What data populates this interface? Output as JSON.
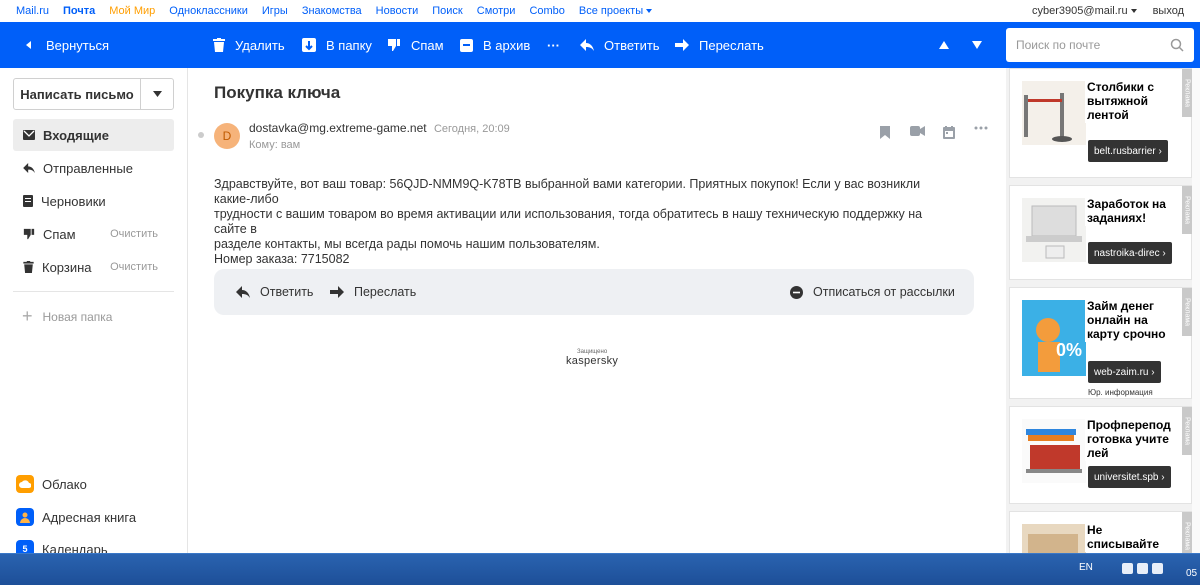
{
  "portal": {
    "links": [
      "Mail.ru",
      "Почта",
      "Мой Мир",
      "Одноклассники",
      "Игры",
      "Знакомства",
      "Новости",
      "Поиск",
      "Смотри",
      "Combo",
      "Все проекты"
    ],
    "user": "cyber3905@mail.ru",
    "logout": "выход"
  },
  "toolbar": {
    "back": "Вернуться",
    "delete": "Удалить",
    "to_folder": "В папку",
    "spam": "Спам",
    "archive": "В архив",
    "more": "···",
    "reply": "Ответить",
    "forward": "Переслать",
    "search_placeholder": "Поиск по почте"
  },
  "sidebar": {
    "compose": "Написать письмо",
    "folders": [
      {
        "label": "Входящие"
      },
      {
        "label": "Отправленные"
      },
      {
        "label": "Черновики"
      },
      {
        "label": "Спам",
        "action": "Очистить"
      },
      {
        "label": "Корзина",
        "action": "Очистить"
      }
    ],
    "new_folder": "Новая папка",
    "services": [
      {
        "label": "Облако"
      },
      {
        "label": "Адресная книга"
      },
      {
        "label": "Календарь",
        "icon_text": "5"
      }
    ]
  },
  "message": {
    "subject": "Покупка ключа",
    "avatar_letter": "D",
    "from": "dostavka@mg.extreme-game.net",
    "date": "Сегодня, 20:09",
    "to": "Кому: вам",
    "body_lines": [
      "Здравствуйте, вот ваш товар: 56QJD-NMM9Q-K78TB выбранной вами категории. Приятных покупок! Если у вас возникли какие-либо",
      "трудности с вашим товаром во время активации или использования, тогда обратитесь в нашу техническую поддержку на сайте в",
      "разделе контакты, мы всегда рады помочь нашим пользователям.",
      "Номер заказа: 7715082"
    ],
    "reply": "Ответить",
    "forward": "Переслать",
    "unsubscribe": "Отписаться от рассылки",
    "protected_small": "Защищено",
    "protected_brand": "kaspersky"
  },
  "ads": [
    {
      "title": "Столбики с вытяжной лентой",
      "button": "belt.rusbarrier",
      "tag": "Реклама"
    },
    {
      "title": "Заработок на заданиях!",
      "button": "nastroika-direc",
      "tag": "Реклама"
    },
    {
      "title": "Займ денег онлайн на карту срочно",
      "button": "web-zaim.ru",
      "legal": "Юр. информация",
      "tag": "Реклама",
      "image_text": "0%"
    },
    {
      "title": "Профпереподготовка учителей",
      "button": "universitet.spb",
      "tag": "Реклама"
    },
    {
      "title": "Не списывайте",
      "tag": "Реклама"
    }
  ],
  "taskbar": {
    "lang": "EN",
    "clock": "05"
  },
  "colors": {
    "brand_blue": "#005ff9",
    "accent_orange": "#ff9e00",
    "taskbar": "#1d4f98"
  }
}
